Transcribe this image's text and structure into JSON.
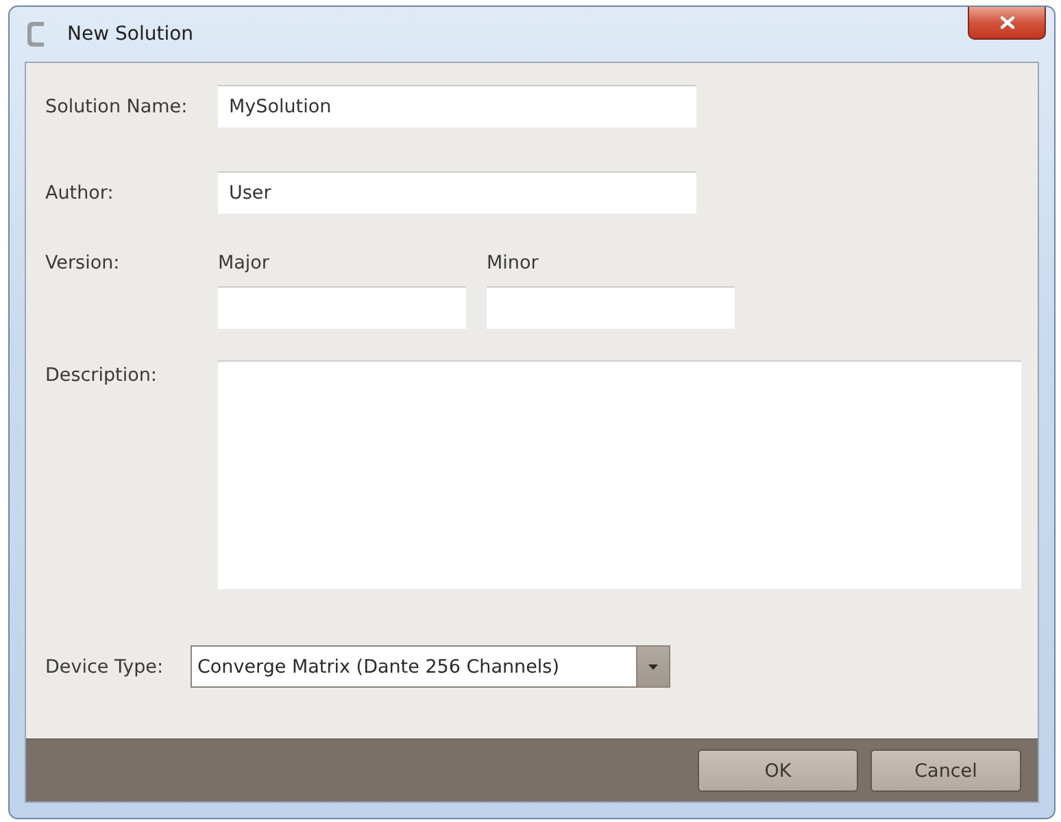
{
  "window": {
    "title": "New Solution"
  },
  "fields": [
    {
      "label": "Solution Name:",
      "value": "MySolution"
    },
    {
      "label": "Author:",
      "value": "User"
    }
  ],
  "version": {
    "label": "Version:",
    "major": {
      "label": "Major"
    },
    "minor": {
      "label": "Minor"
    }
  },
  "description": {
    "label": "Description:"
  },
  "device_type": {
    "label": "Device Type:",
    "value": "Converge Matrix (Dante 256 Channels)"
  },
  "buttons": [
    {
      "label": "OK"
    },
    {
      "label": "Cancel"
    }
  ]
}
